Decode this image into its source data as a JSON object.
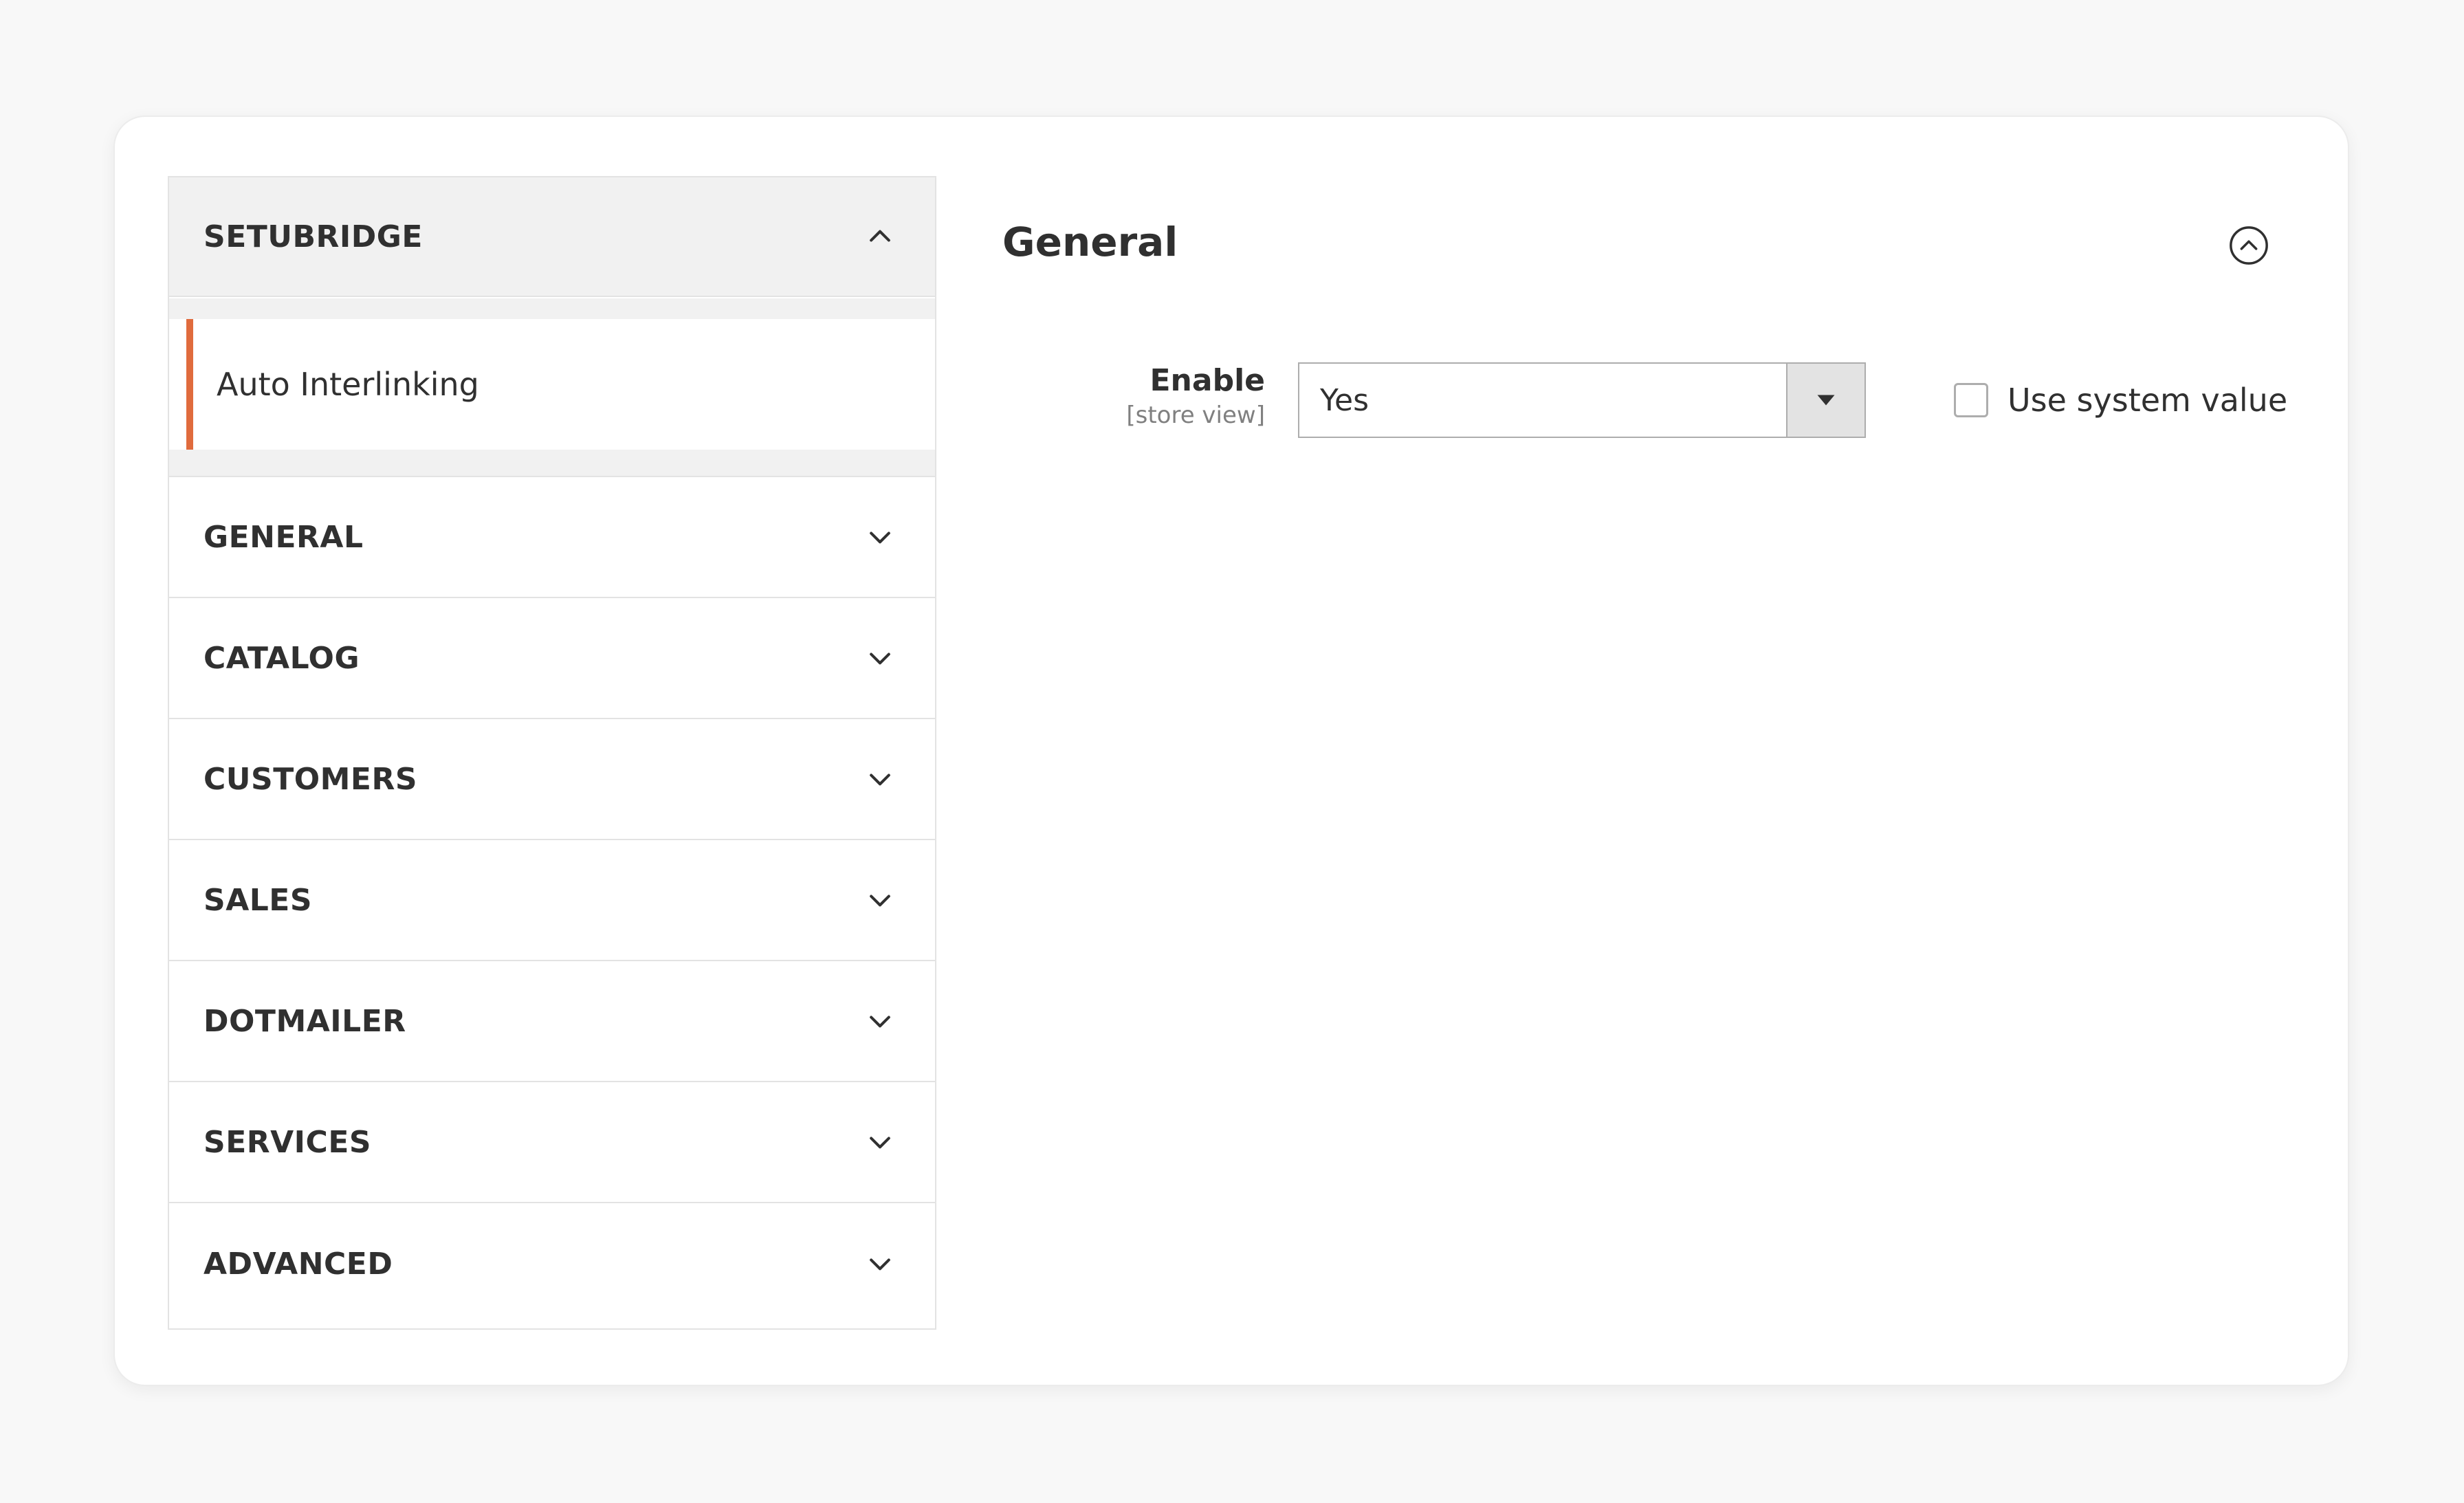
{
  "sidebar": {
    "open_section": {
      "label": "SETUBRIDGE",
      "items": [
        {
          "label": "Auto Interlinking"
        }
      ]
    },
    "sections": [
      {
        "label": "GENERAL"
      },
      {
        "label": "CATALOG"
      },
      {
        "label": "CUSTOMERS"
      },
      {
        "label": "SALES"
      },
      {
        "label": "DOTMAILER"
      },
      {
        "label": "SERVICES"
      },
      {
        "label": "ADVANCED"
      }
    ]
  },
  "main": {
    "title": "General",
    "fields": [
      {
        "label": "Enable",
        "scope": "[store view]",
        "value": "Yes",
        "use_system_value_label": "Use system value",
        "use_system_value_checked": false
      }
    ]
  },
  "colors": {
    "accent": "#e06b3d",
    "text": "#303030",
    "muted": "#808080",
    "section_bg": "#f1f1f1"
  },
  "icons": {
    "open_section": "chevron-up-icon",
    "closed_section": "chevron-down-icon",
    "collapse": "collapse-circle-icon",
    "select_arrow": "caret-down-icon"
  }
}
